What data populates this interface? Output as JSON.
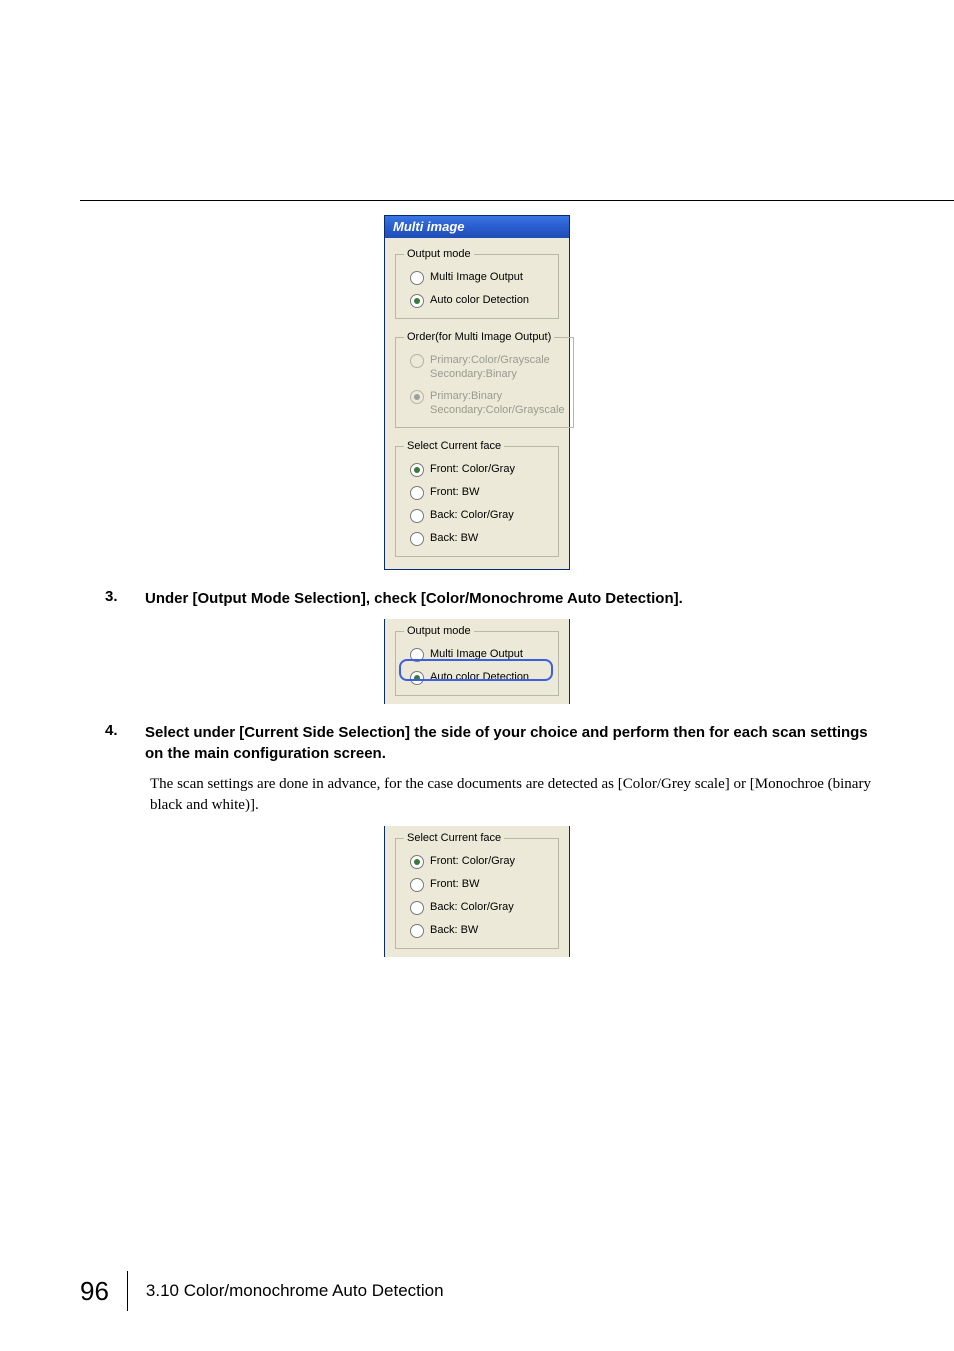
{
  "dialog": {
    "title": "Multi image",
    "output_mode": {
      "legend": "Output mode",
      "multi_image_output": "Multi Image Output",
      "auto_color_detection": "Auto color Detection",
      "selected": "auto"
    },
    "order": {
      "legend": "Order(for Multi Image Output)",
      "opt1": "Primary:Color/Grayscale\nSecondary:Binary",
      "opt2": "Primary:Binary\nSecondary:Color/Grayscale",
      "selected": "opt2",
      "disabled": true
    },
    "current_face": {
      "legend": "Select Current face",
      "front_color": "Front: Color/Gray",
      "front_bw": "Front: BW",
      "back_color": "Back: Color/Gray",
      "back_bw": "Back: BW",
      "selected": "front_color"
    }
  },
  "steps": {
    "s3": {
      "num": "3.",
      "text": "Under [Output Mode Selection], check [Color/Monochrome Auto Detection]."
    },
    "s4": {
      "num": "4.",
      "text": "Select under [Current Side Selection] the side of your choice and perform then for each scan settings on the main configuration screen."
    }
  },
  "paragraph": "The scan settings are done in advance,   for the case documents are detected as [Color/Grey scale] or [Monochroe (binary black and white)].",
  "footer": {
    "page": "96",
    "section": "3.10 Color/monochrome Auto Detection"
  }
}
